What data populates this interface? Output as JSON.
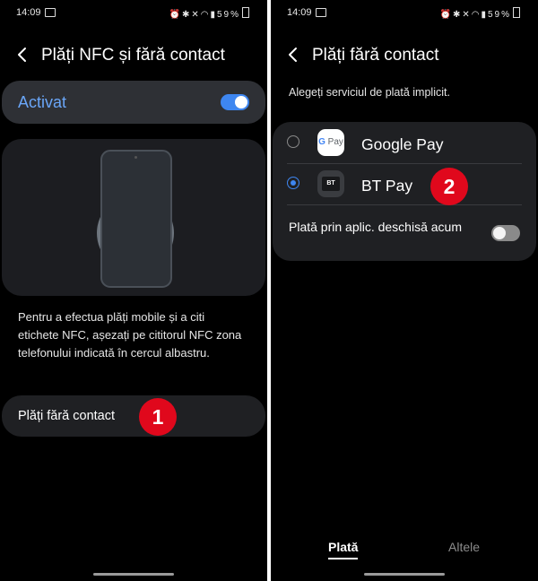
{
  "left": {
    "status": {
      "time": "14:09",
      "battery": "59%"
    },
    "title": "Plăți NFC și fără contact",
    "master_switch": {
      "label": "Activat",
      "on": true
    },
    "description": "Pentru a efectua plăți mobile și a citi etichete NFC, așezați pe cititorul NFC zona telefonului indicată în cercul albastru.",
    "contactless_item": {
      "label": "Plăți fără contact"
    },
    "step_badge": "1"
  },
  "right": {
    "status": {
      "time": "14:09",
      "battery": "59%"
    },
    "title": "Plăți fără contact",
    "subtitle": "Alegeți serviciul de plată implicit.",
    "payment_options": [
      {
        "name": "Google Pay",
        "icon": "google-pay-icon",
        "selected": false
      },
      {
        "name": "BT Pay",
        "icon": "bt-pay-icon",
        "selected": true
      }
    ],
    "open_app_toggle": {
      "label": "Plată prin aplic. deschisă acum",
      "on": false
    },
    "step_badge": "2",
    "tabs": [
      {
        "label": "Plată",
        "active": true
      },
      {
        "label": "Altele",
        "active": false
      }
    ]
  },
  "colors": {
    "accent": "#3e86f0",
    "badge": "#e0081c",
    "card": "#1f2023",
    "background": "#000000"
  }
}
